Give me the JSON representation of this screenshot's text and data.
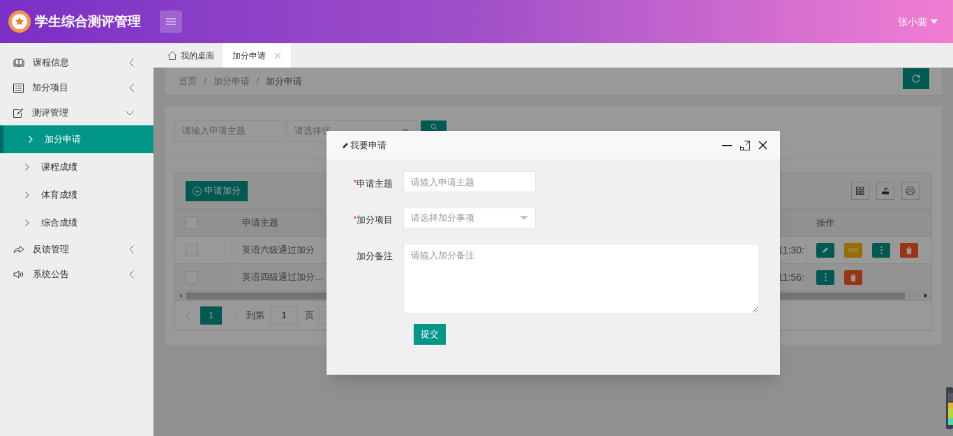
{
  "header": {
    "title": "学生综合测评管理",
    "user_name": "张小裴"
  },
  "sidebar": {
    "items": [
      {
        "label": "课程信息",
        "expanded": false
      },
      {
        "label": "加分项目",
        "expanded": false
      },
      {
        "label": "测评管理",
        "expanded": true,
        "children": [
          {
            "label": "加分申请",
            "selected": true
          },
          {
            "label": "课程成绩",
            "selected": false
          },
          {
            "label": "体育成绩",
            "selected": false
          },
          {
            "label": "综合成绩",
            "selected": false
          }
        ]
      },
      {
        "label": "反馈管理",
        "expanded": false
      },
      {
        "label": "系统公告",
        "expanded": false
      }
    ]
  },
  "tabs": [
    {
      "label": "我的桌面",
      "selected": false,
      "kind": "home"
    },
    {
      "label": "加分申请",
      "selected": true,
      "kind": "closable"
    }
  ],
  "breadcrumb": {
    "separator": "/",
    "items": [
      "首页",
      "加分申请",
      "加分申请"
    ]
  },
  "filter": {
    "title_placeholder": "请输入申请主题",
    "status_placeholder": "请选择状"
  },
  "toolbar": {
    "add_button": "申请加分"
  },
  "table": {
    "columns": [
      "申请主题",
      "操作"
    ],
    "all_checked": false,
    "rows": [
      {
        "checked": false,
        "title": "英语六级通过加分",
        "time": "11:30:",
        "actions": [
          {
            "kind": "edit"
          },
          {
            "kind": "link"
          },
          {
            "kind": "more"
          },
          {
            "kind": "delete"
          }
        ]
      },
      {
        "checked": false,
        "title": "英语四级通过加分…",
        "time": "11:56:",
        "actions": [
          {
            "kind": "more"
          },
          {
            "kind": "delete"
          }
        ]
      }
    ]
  },
  "pagination": {
    "current": "1",
    "goto_label": "到第",
    "goto_value": "1",
    "page_label": "页"
  },
  "dialog": {
    "title": "我要申请",
    "required_mark": "*",
    "fields": [
      {
        "label": "申请主题",
        "required": true,
        "kind": "input",
        "placeholder": "请输入申请主题"
      },
      {
        "label": "加分项目",
        "required": true,
        "kind": "select",
        "placeholder": "请选择加分事项"
      },
      {
        "label": "加分备注",
        "required": false,
        "kind": "textarea",
        "placeholder": "请输入加分备注"
      }
    ],
    "submit": "提交"
  }
}
